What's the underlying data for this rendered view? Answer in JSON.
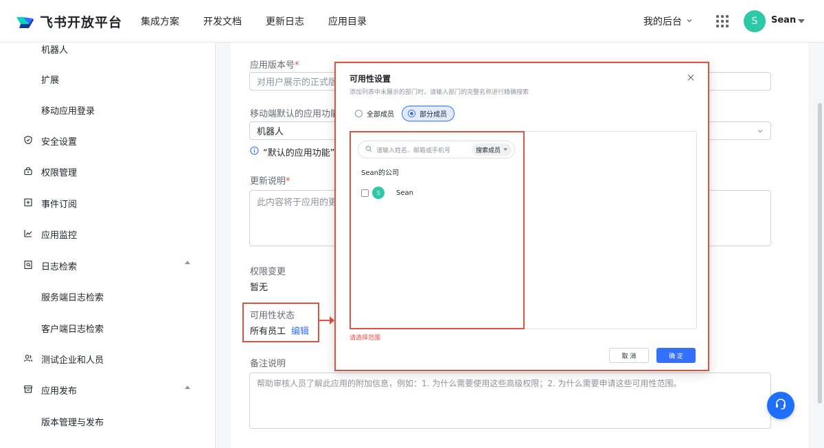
{
  "header": {
    "brand": "飞书开放平台",
    "nav": [
      "集成方案",
      "开发文档",
      "更新日志",
      "应用目录"
    ],
    "backend_label": "我的后台",
    "user": {
      "initial": "S",
      "name": "Sean"
    }
  },
  "sidebar": {
    "items": [
      {
        "label": "机器人",
        "icon": ""
      },
      {
        "label": "扩展",
        "icon": ""
      },
      {
        "label": "移动应用登录",
        "icon": ""
      },
      {
        "label": "安全设置",
        "icon": "shield-icon"
      },
      {
        "label": "权限管理",
        "icon": "lock-icon"
      },
      {
        "label": "事件订阅",
        "icon": "event-icon"
      },
      {
        "label": "应用监控",
        "icon": "chart-icon"
      },
      {
        "label": "日志检索",
        "icon": "log-icon"
      },
      {
        "label": "服务端日志检索",
        "icon": ""
      },
      {
        "label": "客户端日志检索",
        "icon": ""
      },
      {
        "label": "测试企业和人员",
        "icon": "users-icon"
      },
      {
        "label": "应用发布",
        "icon": "store-icon"
      },
      {
        "label": "版本管理与发布",
        "icon": ""
      }
    ]
  },
  "form": {
    "version_label": "应用版本号",
    "version_placeholder": "对用户展示的正式版",
    "mobile_default_label": "移动端默认的应用功能",
    "mobile_default_value": "机器人",
    "info_text": "“默认的应用功能”即",
    "update_label": "更新说明",
    "update_placeholder": "此内容将于应用的更",
    "perm_change_label": "权限变更",
    "perm_change_value": "暂无",
    "avail_label": "可用性状态",
    "avail_value": "所有员工",
    "avail_edit": "编辑",
    "remark_label": "备注说明",
    "remark_placeholder": "帮助审核人员了解此应用的附加信息，例如：1. 为什么需要使用这些高级权限；2. 为什么需要申请这些可用性范围。"
  },
  "modal": {
    "title": "可用性设置",
    "subtitle": "添加列表中未展示的部门时，请输入部门的完整名称进行精确搜索",
    "option_all": "全部成员",
    "option_partial": "部分成员",
    "search_placeholder": "请输入姓名、邮箱或手机号",
    "search_scope": "搜索成员",
    "company": "Sean的公司",
    "member": {
      "initial": "S",
      "name": "Sean"
    },
    "error": "请选择范围",
    "cancel": "取 消",
    "confirm": "确 定"
  }
}
